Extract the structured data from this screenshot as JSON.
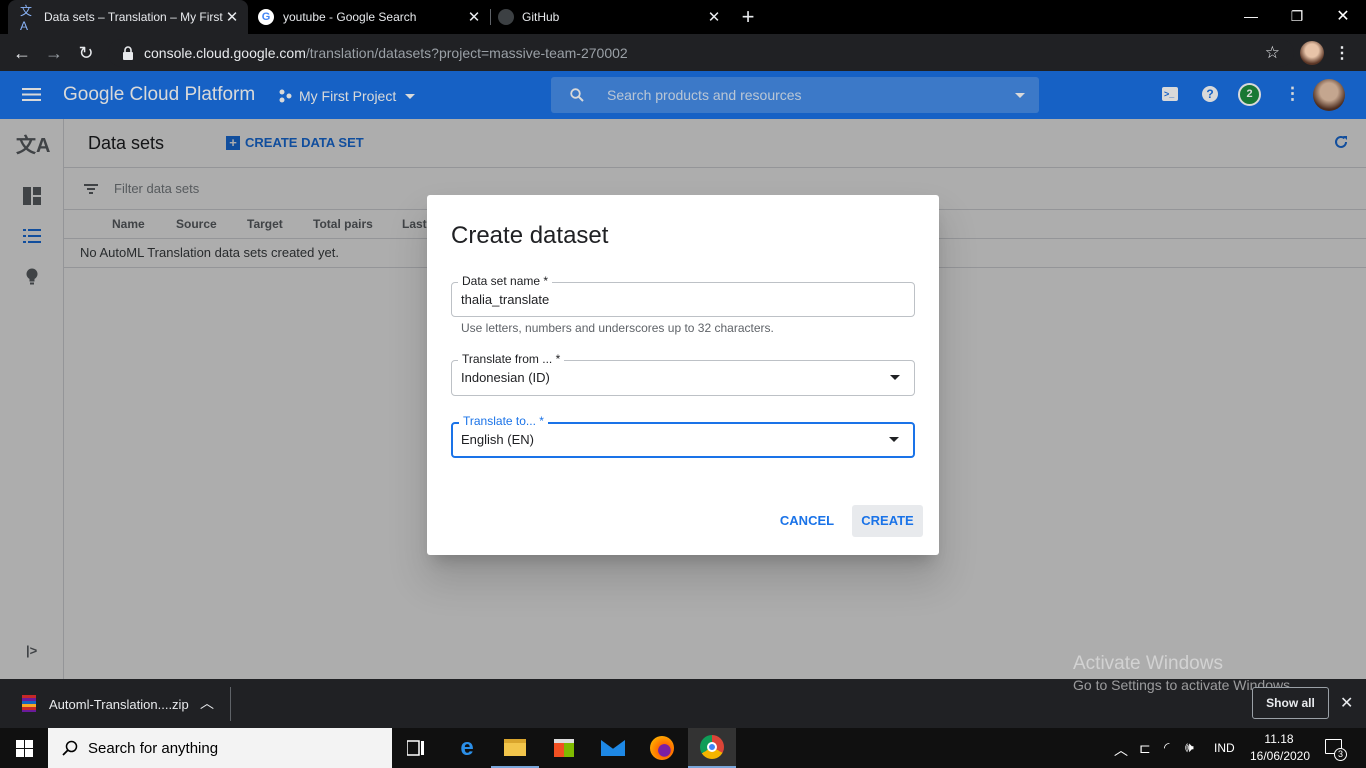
{
  "browser": {
    "tabs": [
      {
        "title": "Data sets – Translation – My First",
        "active": true
      },
      {
        "title": "youtube - Google Search",
        "active": false
      },
      {
        "title": "GitHub",
        "active": false
      }
    ],
    "url_host": "console.cloud.google.com",
    "url_path": "/translation/datasets?project=massive-team-270002"
  },
  "gcp": {
    "brand": "Google Cloud Platform",
    "project": "My First Project",
    "search_placeholder": "Search products and resources",
    "notification_count": "2",
    "colors": {
      "header_blue": "#1a73e8",
      "link_blue": "#1a73e8"
    }
  },
  "page": {
    "title": "Data sets",
    "create_label": "CREATE DATA SET",
    "filter_placeholder": "Filter data sets",
    "columns": [
      "Name",
      "Source",
      "Target",
      "Total pairs",
      "Last"
    ],
    "empty_text": "No AutoML Translation data sets created yet."
  },
  "dialog": {
    "title": "Create dataset",
    "name_label": "Data set name *",
    "name_value": "thalia_translate",
    "name_hint": "Use letters, numbers and underscores up to 32 characters.",
    "from_label": "Translate from ... *",
    "from_value": "Indonesian (ID)",
    "to_label": "Translate to... *",
    "to_value": "English (EN)",
    "cancel_label": "CANCEL",
    "create_label": "CREATE"
  },
  "downloads": {
    "file": "Automl-Translation....zip",
    "show_all": "Show all"
  },
  "watermark": {
    "title": "Activate Windows",
    "subtitle": "Go to Settings to activate Windows."
  },
  "taskbar": {
    "search_placeholder": "Search for anything",
    "lang": "IND",
    "time": "11.18",
    "date": "16/06/2020",
    "notif_count": "3"
  }
}
